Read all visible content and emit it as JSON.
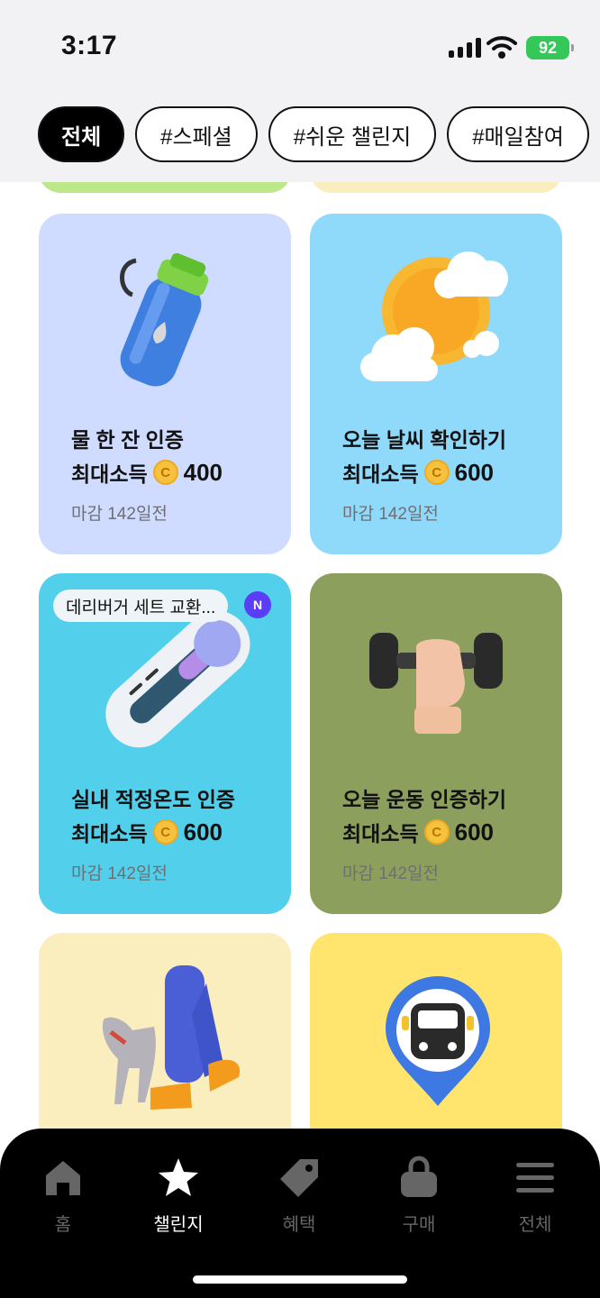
{
  "status": {
    "time": "3:17",
    "battery": "92"
  },
  "chips": [
    "전체",
    "#스페셜",
    "#쉬운 챌린지",
    "#매일참여",
    "#"
  ],
  "reward_label": "최대소득",
  "coin_letter": "C",
  "cards": [
    {
      "title": "물 한 잔 인증",
      "reward": "400",
      "deadline": "마감 142일전",
      "bg": "#cfdcff",
      "icon": "water-bottle-icon"
    },
    {
      "title": "오늘 날씨 확인하기",
      "reward": "600",
      "deadline": "마감 142일전",
      "bg": "#8fd9fb",
      "icon": "sun-cloud-icon"
    },
    {
      "title": "실내 적정온도 인증",
      "reward": "600",
      "deadline": "마감 142일전",
      "bg": "#52d0eb",
      "icon": "thermometer-icon",
      "promo": "데리버거 세트 교환...",
      "badge": "N"
    },
    {
      "title": "오늘 운동 인증하기",
      "reward": "600",
      "deadline": "마감 142일전",
      "bg": "#8d9f5c",
      "icon": "dumbbell-icon"
    },
    {
      "bg": "#faeebf",
      "icon": "dog-walk-icon"
    },
    {
      "bg": "#ffe56e",
      "icon": "bus-pin-icon"
    }
  ],
  "tabs": [
    {
      "label": "홈",
      "icon": "home-icon"
    },
    {
      "label": "챌린지",
      "icon": "star-icon"
    },
    {
      "label": "혜택",
      "icon": "tag-icon"
    },
    {
      "label": "구매",
      "icon": "bag-icon"
    },
    {
      "label": "전체",
      "icon": "menu-icon"
    }
  ]
}
